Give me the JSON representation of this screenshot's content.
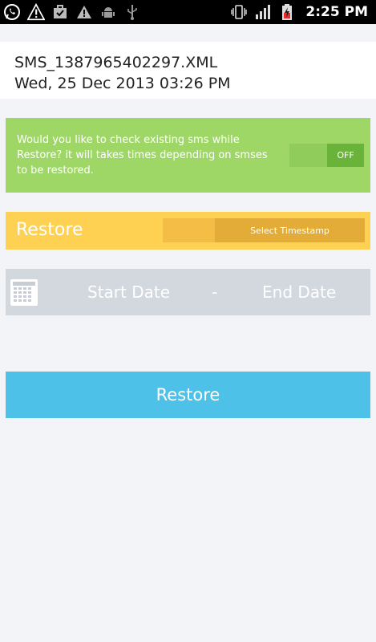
{
  "status_bar": {
    "time": "2:25 PM",
    "icons_left": [
      "whatsapp-icon",
      "warning-icon",
      "briefcase-icon",
      "warning-small-icon",
      "android-icon",
      "usb-icon"
    ],
    "icons_right": [
      "vibrate-icon",
      "signal-icon",
      "battery-icon"
    ]
  },
  "file": {
    "name": "SMS_1387965402297.XML",
    "date": "Wed, 25 Dec 2013 03:26 PM"
  },
  "check_existing": {
    "message": "Would you like to check existing sms while Restore? it will takes times depending on smses to be restored.",
    "toggle_label": "OFF",
    "toggle_state": "off"
  },
  "restore_mode": {
    "label": "Restore",
    "option_label": "Select Timestamp"
  },
  "date_range": {
    "start_label": "Start Date",
    "separator": "-",
    "end_label": "End Date"
  },
  "actions": {
    "restore_button": "Restore"
  },
  "colors": {
    "green_panel": "#9ed766",
    "yellow_bar": "#ffd153",
    "date_bar": "#d3d7de",
    "restore_button": "#4ec1e8",
    "background": "#f3f4f8"
  }
}
